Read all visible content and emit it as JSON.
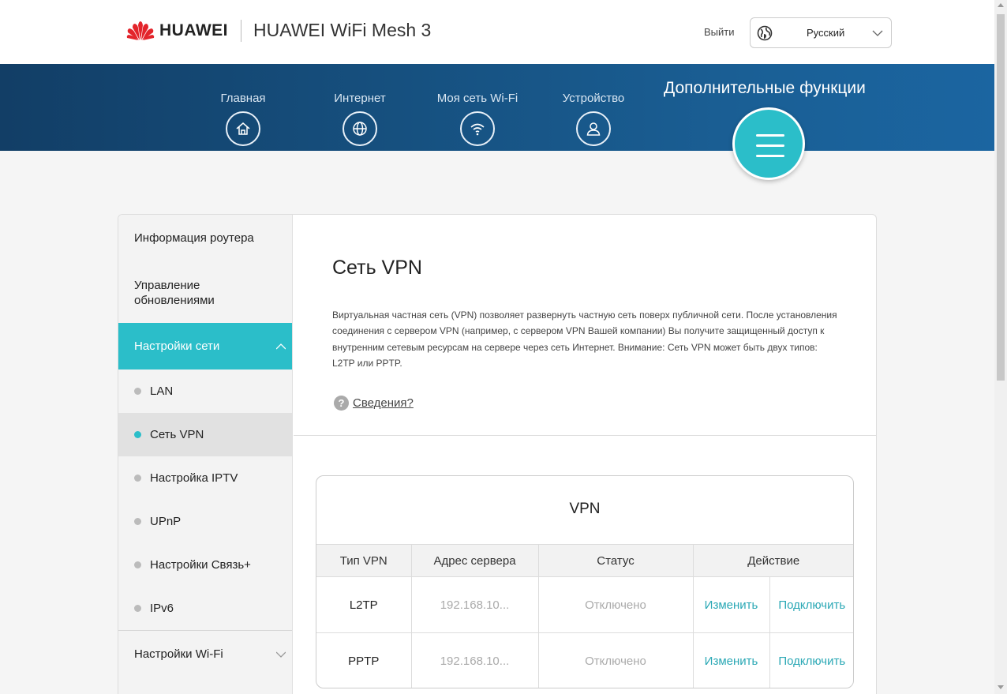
{
  "header": {
    "brand": "HUAWEI",
    "product": "HUAWEI WiFi Mesh 3",
    "logout": "Выйти",
    "language": "Русский"
  },
  "nav": {
    "items": [
      {
        "label": "Главная",
        "icon": "home-icon"
      },
      {
        "label": "Интернет",
        "icon": "globe-icon"
      },
      {
        "label": "Моя сеть Wi-Fi",
        "icon": "wifi-icon"
      },
      {
        "label": "Устройство",
        "icon": "user-icon"
      }
    ],
    "advanced": "Дополнительные функции"
  },
  "sidebar": {
    "items": [
      {
        "label": "Информация роутера"
      },
      {
        "label": "Управление обновлениями"
      },
      {
        "label": "Настройки сети",
        "expanded": true
      },
      {
        "label": "Настройки Wi-Fi",
        "expanded": false
      }
    ],
    "network_sub": [
      {
        "label": "LAN"
      },
      {
        "label": "Сеть VPN",
        "active": true
      },
      {
        "label": "Настройка IPTV"
      },
      {
        "label": "UPnP"
      },
      {
        "label": "Настройки Связь+"
      },
      {
        "label": "IPv6"
      }
    ]
  },
  "main": {
    "title": "Сеть VPN",
    "description": "Виртуальная частная сеть (VPN) позволяет развернуть частную сеть поверх публичной сети. После установления соединения с сервером VPN (например, с сервером VPN Вашей компании) Вы получите защищенный доступ к внутренним сетевым ресурсам на сервере через сеть Интернет. Внимание: Сеть VPN может быть двух типов: L2TP или PPTP.",
    "help_icon": "?",
    "help_link": "Сведения?",
    "vpn_table": {
      "title": "VPN",
      "headers": [
        "Тип VPN",
        "Адрес сервера",
        "Статус",
        "Действие"
      ],
      "rows": [
        {
          "type": "L2TP",
          "server": "192.168.10...",
          "status": "Отключено",
          "edit": "Изменить",
          "connect": "Подключить"
        },
        {
          "type": "PPTP",
          "server": "192.168.10...",
          "status": "Отключено",
          "edit": "Изменить",
          "connect": "Подключить"
        }
      ]
    }
  },
  "colors": {
    "accent": "#2bbec9",
    "nav_band": "#16507f",
    "link": "#2aa8b5"
  }
}
